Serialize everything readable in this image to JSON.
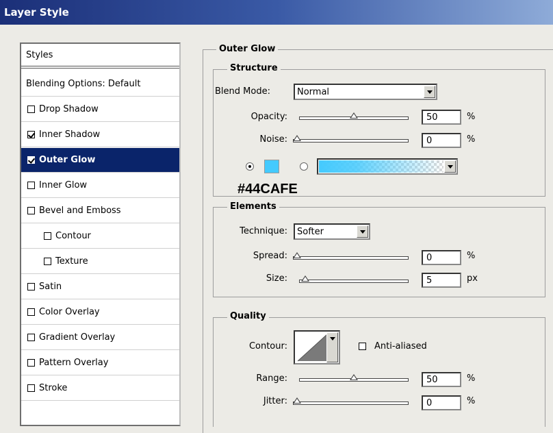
{
  "window": {
    "title": "Layer Style"
  },
  "styles_list": {
    "header": "Styles",
    "items": [
      {
        "label": "Blending Options: Default",
        "has_checkbox": false,
        "checked": false,
        "indent": false,
        "selected": false
      },
      {
        "label": "Drop Shadow",
        "has_checkbox": true,
        "checked": false,
        "indent": false,
        "selected": false
      },
      {
        "label": "Inner Shadow",
        "has_checkbox": true,
        "checked": true,
        "indent": false,
        "selected": false
      },
      {
        "label": "Outer Glow",
        "has_checkbox": true,
        "checked": true,
        "indent": false,
        "selected": true
      },
      {
        "label": "Inner Glow",
        "has_checkbox": true,
        "checked": false,
        "indent": false,
        "selected": false
      },
      {
        "label": "Bevel and Emboss",
        "has_checkbox": true,
        "checked": false,
        "indent": false,
        "selected": false
      },
      {
        "label": "Contour",
        "has_checkbox": true,
        "checked": false,
        "indent": true,
        "selected": false
      },
      {
        "label": "Texture",
        "has_checkbox": true,
        "checked": false,
        "indent": true,
        "selected": false
      },
      {
        "label": "Satin",
        "has_checkbox": true,
        "checked": false,
        "indent": false,
        "selected": false
      },
      {
        "label": "Color Overlay",
        "has_checkbox": true,
        "checked": false,
        "indent": false,
        "selected": false
      },
      {
        "label": "Gradient Overlay",
        "has_checkbox": true,
        "checked": false,
        "indent": false,
        "selected": false
      },
      {
        "label": "Pattern Overlay",
        "has_checkbox": true,
        "checked": false,
        "indent": false,
        "selected": false
      },
      {
        "label": "Stroke",
        "has_checkbox": true,
        "checked": false,
        "indent": false,
        "selected": false
      }
    ]
  },
  "outer_glow": {
    "title": "Outer Glow",
    "structure": {
      "title": "Structure",
      "blend_mode_label": "Blend Mode:",
      "blend_mode_value": "Normal",
      "opacity_label": "Opacity:",
      "opacity_value": "50",
      "opacity_level": 0.5,
      "opacity_unit": "%",
      "noise_label": "Noise:",
      "noise_value": "0",
      "noise_level": 0,
      "noise_unit": "%",
      "color_selected": true,
      "gradient_selected": false,
      "swatch_color": "#44CAFE",
      "hex_label": "#44CAFE"
    },
    "elements": {
      "title": "Elements",
      "technique_label": "Technique:",
      "technique_value": "Softer",
      "spread_label": "Spread:",
      "spread_value": "0",
      "spread_level": 0,
      "spread_unit": "%",
      "size_label": "Size:",
      "size_value": "5",
      "size_level": 0.02,
      "size_unit": "px"
    },
    "quality": {
      "title": "Quality",
      "contour_label": "Contour:",
      "anti_aliased_label": "Anti-aliased",
      "anti_aliased_checked": false,
      "range_label": "Range:",
      "range_value": "50",
      "range_level": 0.5,
      "range_unit": "%",
      "jitter_label": "Jitter:",
      "jitter_value": "0",
      "jitter_level": 0,
      "jitter_unit": "%"
    }
  }
}
